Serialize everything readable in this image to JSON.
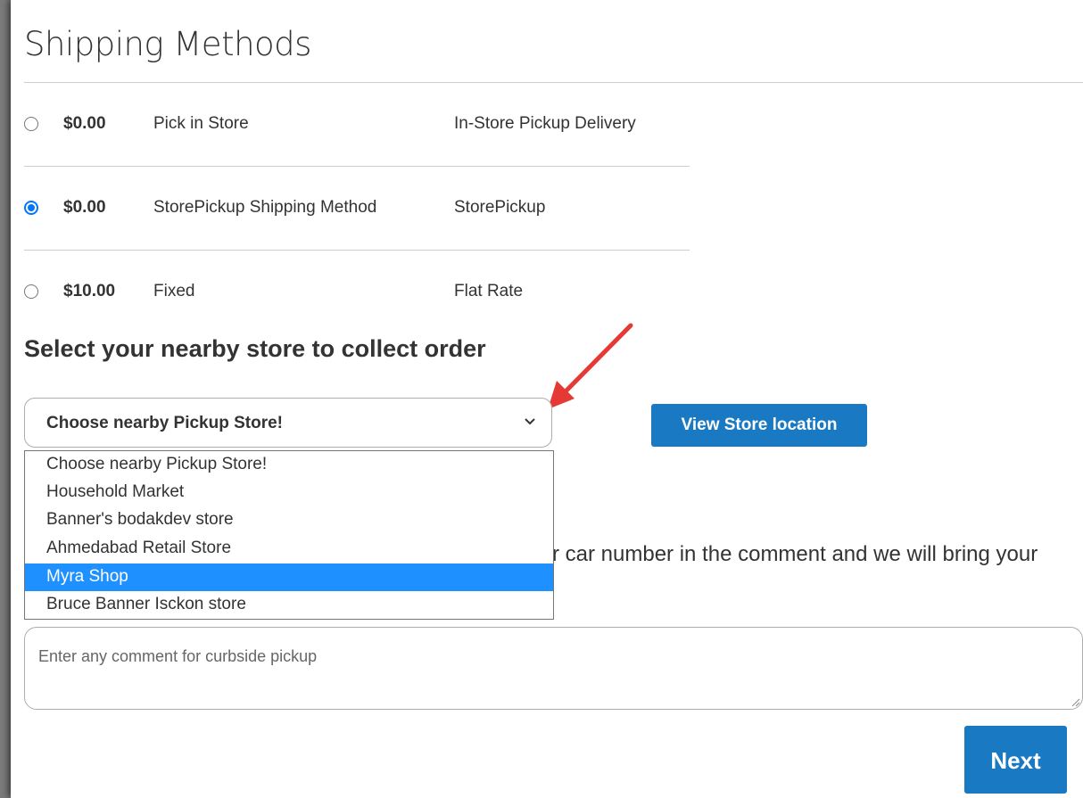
{
  "header": {
    "title": "Shipping Methods"
  },
  "shipping_methods": [
    {
      "price": "$0.00",
      "method": "Pick in Store",
      "carrier": "In-Store Pickup Delivery",
      "selected": false
    },
    {
      "price": "$0.00",
      "method": "StorePickup Shipping Method",
      "carrier": "StorePickup",
      "selected": true
    },
    {
      "price": "$10.00",
      "method": "Fixed",
      "carrier": "Flat Rate",
      "selected": false
    }
  ],
  "store_section": {
    "title": "Select your nearby store to collect order",
    "select_value": "Choose nearby Pickup Store!",
    "options": [
      "Choose nearby Pickup Store!",
      "Household Market",
      "Banner's bodakdev store",
      "Ahmedabad Retail Store",
      "Myra Shop",
      "Bruce Banner Isckon store"
    ],
    "highlighted_option": "Myra Shop",
    "view_button": "View Store location"
  },
  "curbside": {
    "visible_text": "r car number in the comment and we will bring your",
    "comment_placeholder": "Enter any comment for curbside pickup"
  },
  "actions": {
    "next_label": "Next"
  },
  "icons": {
    "select_chevron": "chevron-down-icon",
    "annotation": "red-arrow-icon",
    "resize": "resize-grip-icon"
  },
  "colors": {
    "accent": "#1979c3",
    "highlight": "#1e90ff",
    "radio": "#0075ff",
    "annotation_arrow": "#e53935"
  }
}
